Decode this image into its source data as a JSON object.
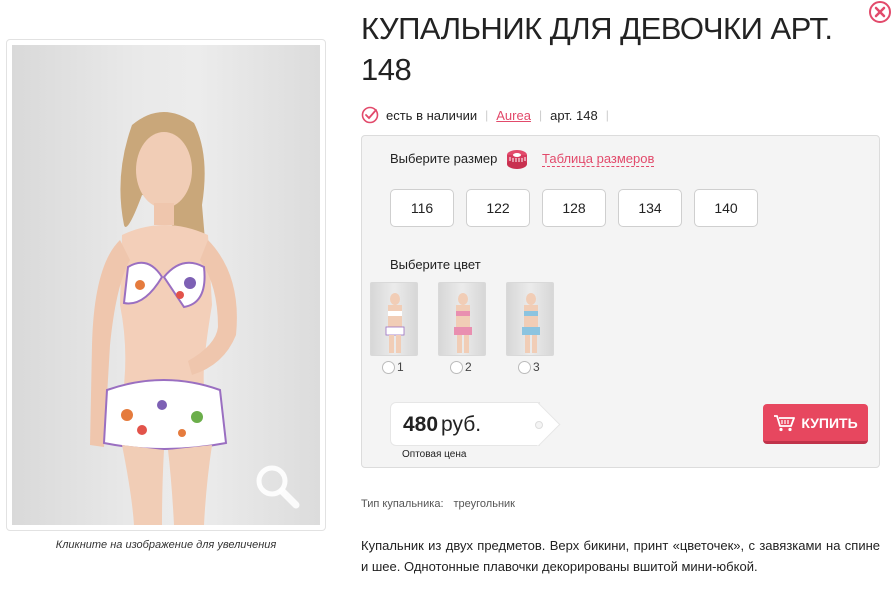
{
  "product": {
    "title": "КУПАЛЬНИК ДЛЯ ДЕВОЧКИ АРТ. 148",
    "availability": "есть в наличии",
    "brand": "Aurea",
    "article": "арт. 148"
  },
  "gallery": {
    "caption": "Кликните на изображение для увеличения"
  },
  "size": {
    "label": "Выберите размер",
    "size_table_link": "Таблица размеров",
    "options": [
      "116",
      "122",
      "128",
      "134",
      "140"
    ]
  },
  "color": {
    "label": "Выберите цвет",
    "options": [
      "1",
      "2",
      "3"
    ]
  },
  "price": {
    "value": "480",
    "unit": "руб.",
    "note": "Оптовая цена"
  },
  "buy_button": {
    "label": "КУПИТЬ"
  },
  "properties": {
    "type_label": "Тип купальника:",
    "type_value": "треугольник"
  },
  "description": "Купальник из двух предметов. Верх бикини, принт «цветочек», с завязками на спине и шее. Однотонные плавочки декорированы вшитой мини-юбкой.",
  "colors": {
    "accent": "#e24a6b",
    "buy_button": "#e7475f",
    "panel_bg": "#f4f4f4"
  }
}
